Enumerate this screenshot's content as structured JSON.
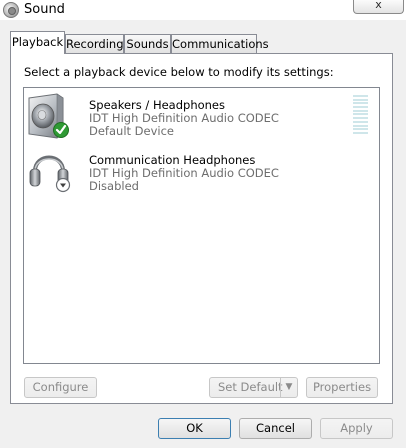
{
  "window": {
    "title": "Sound",
    "close_glyph": "x"
  },
  "tabs": [
    {
      "label": "Playback",
      "active": true
    },
    {
      "label": "Recording",
      "active": false
    },
    {
      "label": "Sounds",
      "active": false
    },
    {
      "label": "Communications",
      "active": false
    }
  ],
  "panel": {
    "instruction": "Select a playback device below to modify its settings:"
  },
  "devices": [
    {
      "name": "Speakers / Headphones",
      "driver": "IDT High Definition Audio CODEC",
      "status": "Default Device",
      "icon": "speaker-icon",
      "badge": "default-check-badge",
      "badge_color": "#2f9a34"
    },
    {
      "name": "Communication Headphones",
      "driver": "IDT High Definition Audio CODEC",
      "status": "Disabled",
      "icon": "headphones-icon",
      "badge": "disabled-down-arrow-badge"
    }
  ],
  "buttons": {
    "configure": "Configure",
    "set_default": "Set Default",
    "properties": "Properties",
    "ok": "OK",
    "cancel": "Cancel",
    "apply": "Apply"
  },
  "colors": {
    "accent_border": "#3c7fb1",
    "level_meter": "#cfe6ea"
  }
}
